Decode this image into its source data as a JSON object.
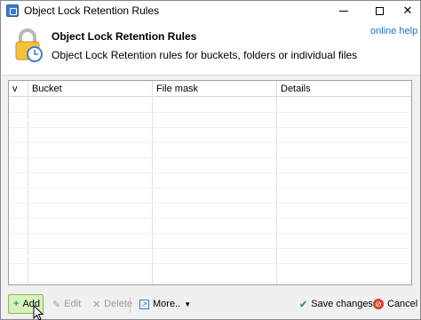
{
  "window": {
    "title": "Object Lock Retention Rules"
  },
  "header": {
    "title": "Object Lock Retention Rules",
    "description": "Object Lock Retention rules for buckets, folders or individual files",
    "help_link": "online help"
  },
  "grid": {
    "columns": [
      "v",
      "Bucket",
      "File mask",
      "Details"
    ],
    "rows": []
  },
  "toolbar": {
    "add": "Add",
    "edit": "Edit",
    "delete": "Delete",
    "more": "More..",
    "save": "Save changes",
    "cancel": "Cancel"
  },
  "colors": {
    "accent_link": "#1a6fd1",
    "add_bg": "#d9f0c0",
    "save_check": "#3aa14a",
    "cancel_icon": "#d9402a"
  },
  "icons": [
    "app-icon",
    "lock-clock-icon",
    "minimize-icon",
    "maximize-icon",
    "close-icon",
    "add-icon",
    "edit-icon",
    "delete-icon",
    "more-icon",
    "check-icon",
    "cancel-icon",
    "mouse-cursor"
  ]
}
